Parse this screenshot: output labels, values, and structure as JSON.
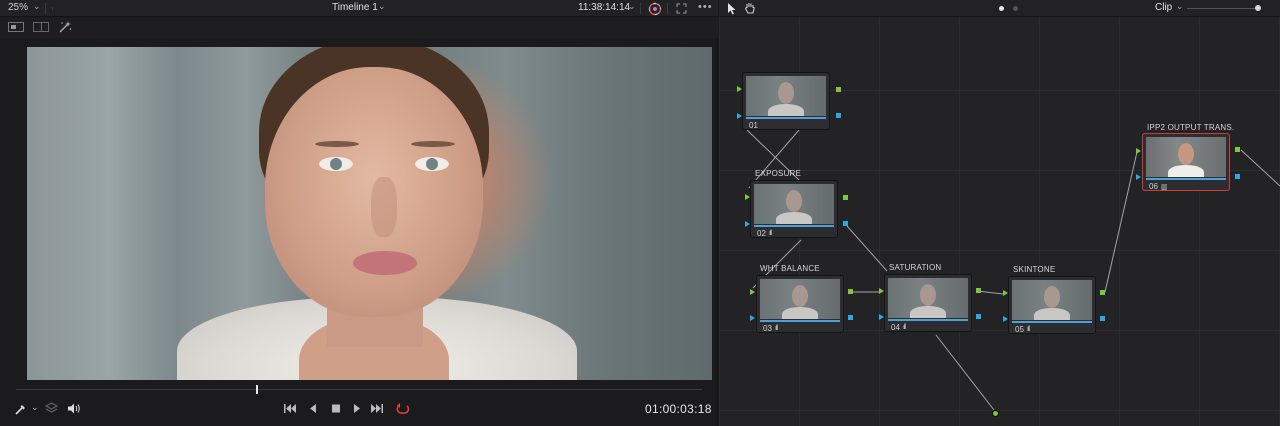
{
  "viewer": {
    "zoom": "25%",
    "timeline_name": "Timeline 1",
    "timecode_top": "11:38:14:14",
    "timecode_bottom": "01:00:03:18",
    "scrub_position": 0.35
  },
  "node_editor": {
    "mode": "Clip",
    "nodes": [
      {
        "num": "01",
        "label": "",
        "bars": ""
      },
      {
        "num": "02",
        "label": "EXPOSURE",
        "bars": "ıll"
      },
      {
        "num": "03",
        "label": "WHT BALANCE",
        "bars": "ıll"
      },
      {
        "num": "04",
        "label": "SATURATION",
        "bars": "ıll"
      },
      {
        "num": "05",
        "label": "SKINTONE",
        "bars": "ıll"
      },
      {
        "num": "06",
        "label": "IPP2 OUTPUT TRANS.",
        "bars": "▥"
      }
    ]
  },
  "icons": {
    "viewer_top": [
      "chevron-down-icon",
      "color-wheel-icon",
      "fullscreen-icon",
      "more-icon"
    ],
    "viewer_toolbar": [
      "single-view-icon",
      "split-view-icon",
      "magic-wand-icon"
    ],
    "viewer_bottom": [
      "eyedropper-icon",
      "layers-icon",
      "volume-icon"
    ],
    "transport": [
      "skip-back-icon",
      "play-reverse-icon",
      "stop-icon",
      "play-icon",
      "skip-forward-icon",
      "loop-icon"
    ],
    "node_top": [
      "pointer-tool-icon",
      "hand-tool-icon"
    ]
  },
  "colors": {
    "rgb_port": "#7fc63a",
    "key_port": "#2aa9e6",
    "selected_node": "#d23a36",
    "loop_active": "#e0413a"
  }
}
